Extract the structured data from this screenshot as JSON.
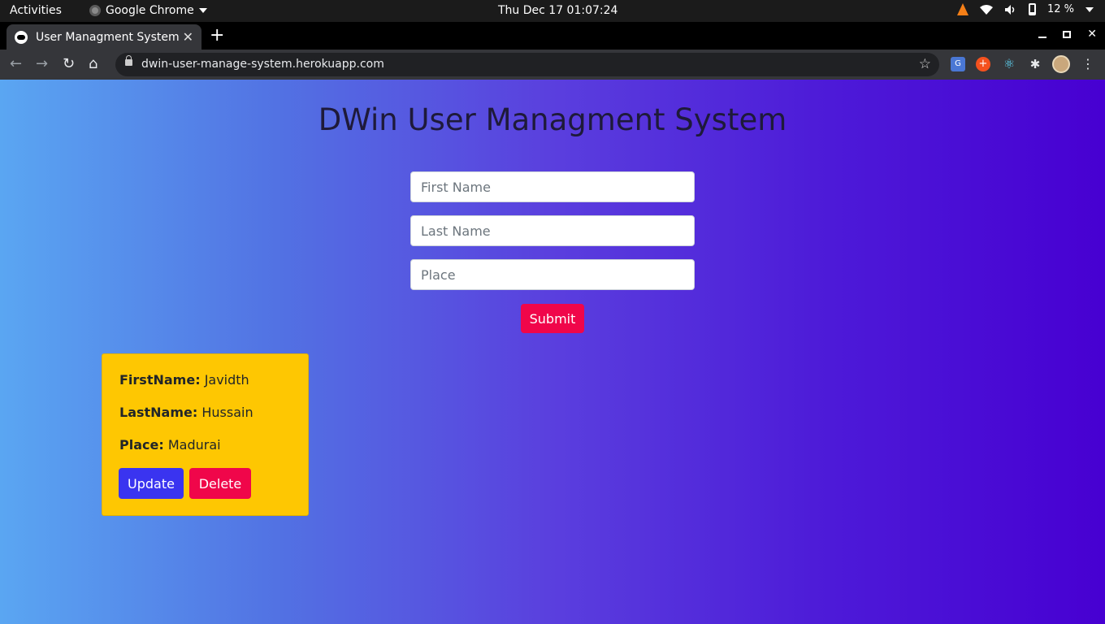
{
  "os_bar": {
    "activities": "Activities",
    "app_name": "Google Chrome",
    "clock": "Thu Dec 17  01:07:24",
    "battery": "12 %"
  },
  "browser": {
    "tab_title": "User Managment System",
    "url": "dwin-user-manage-system.herokuapp.com"
  },
  "page": {
    "heading": "DWin User Managment System",
    "form": {
      "first_name_placeholder": "First Name",
      "last_name_placeholder": "Last Name",
      "place_placeholder": "Place",
      "submit_label": "Submit"
    },
    "users": [
      {
        "first_name_label": "FirstName:",
        "first_name": "Javidth",
        "last_name_label": "LastName:",
        "last_name": "Hussain",
        "place_label": "Place:",
        "place": "Madurai",
        "update_label": "Update",
        "delete_label": "Delete"
      }
    ]
  },
  "colors": {
    "gradient_start": "#5aa6f2",
    "gradient_end": "#4700d2",
    "card": "#fec702",
    "primary_button": "#3a34f0",
    "danger_button": "#f0064a"
  }
}
